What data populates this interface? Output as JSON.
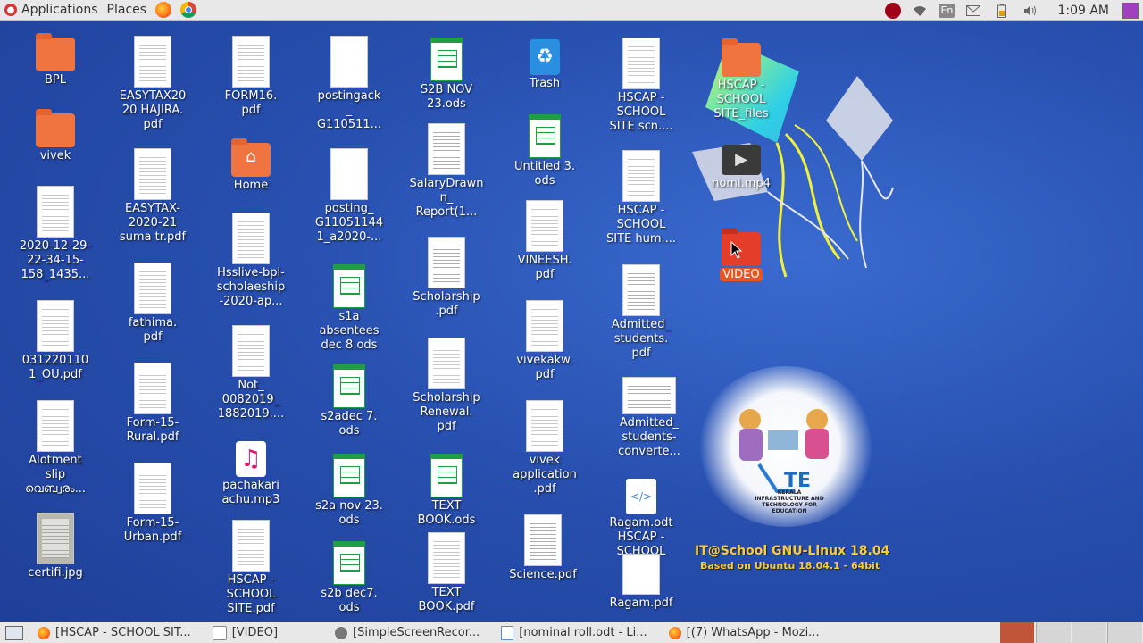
{
  "top_panel": {
    "applications": "Applications",
    "places": "Places",
    "lang": "En",
    "clock": "1:09 AM"
  },
  "desktop": {
    "icons": [
      {
        "label": "BPL",
        "type": "folder"
      },
      {
        "label": "vivek",
        "type": "folder"
      },
      {
        "label": "2020-12-29-\n22-34-15-\n158_1435...",
        "type": "doc"
      },
      {
        "label": "031220110\n1_OU.pdf",
        "type": "doc"
      },
      {
        "label": "Alotment\nslip\nവെബ്വരം...",
        "type": "doc"
      },
      {
        "label": "certifi.jpg",
        "type": "photo"
      },
      {
        "label": "EASYTAX20\n20 HAJIRA.\npdf",
        "type": "doc"
      },
      {
        "label": "EASYTAX-\n2020-21\nsuma tr.pdf",
        "type": "doc"
      },
      {
        "label": "fathima.\npdf",
        "type": "doc"
      },
      {
        "label": "Form-15-\nRural.pdf",
        "type": "doc"
      },
      {
        "label": "Form-15-\nUrban.pdf",
        "type": "doc"
      },
      {
        "label": "FORM16.\npdf",
        "type": "doc"
      },
      {
        "label": "Home",
        "type": "home"
      },
      {
        "label": "Hsslive-bpl-\nscholaeship\n-2020-ap...",
        "type": "doc"
      },
      {
        "label": "Not_\n0082019_\n1882019....",
        "type": "doc"
      },
      {
        "label": "pachakari\nachu.mp3",
        "type": "music"
      },
      {
        "label": "HSCAP -\nSCHOOL\nSITE.pdf",
        "type": "doc"
      },
      {
        "label": "postingack\n_\nG110511...",
        "type": "blank"
      },
      {
        "label": "posting_\nG11051144\n1_a2020-...",
        "type": "blank"
      },
      {
        "label": "s1a\nabsentees\ndec 8.ods",
        "type": "ods"
      },
      {
        "label": "s2adec 7.\nods",
        "type": "ods"
      },
      {
        "label": "s2a nov 23.\nods",
        "type": "ods"
      },
      {
        "label": "s2b dec7.\nods",
        "type": "ods"
      },
      {
        "label": "S2B NOV\n23.ods",
        "type": "ods"
      },
      {
        "label": "SalaryDrawn\nn_\nReport(1...",
        "type": "grid"
      },
      {
        "label": "Scholarship\n.pdf",
        "type": "grid"
      },
      {
        "label": "Scholarship\nRenewal.\npdf",
        "type": "doc"
      },
      {
        "label": "TEXT\nBOOK.ods",
        "type": "ods"
      },
      {
        "label": "TEXT\nBOOK.pdf",
        "type": "doc"
      },
      {
        "label": "Trash",
        "type": "trash"
      },
      {
        "label": "Untitled 3.\nods",
        "type": "ods"
      },
      {
        "label": "VINEESH.\npdf",
        "type": "doc"
      },
      {
        "label": "vivekakw.\npdf",
        "type": "doc"
      },
      {
        "label": "vivek\napplication\n.pdf",
        "type": "doc"
      },
      {
        "label": "Science.pdf",
        "type": "grid"
      },
      {
        "label": "HSCAP -\nSCHOOL\nSITE scn....",
        "type": "doc"
      },
      {
        "label": "HSCAP -\nSCHOOL\nSITE hum....",
        "type": "doc"
      },
      {
        "label": "Admitted_\nstudents.\npdf",
        "type": "grid"
      },
      {
        "label": "Admitted_\nstudents-\nconverte...",
        "type": "wide"
      },
      {
        "label": "Ragam.odt\nHSCAP -\nSCHOOL\nSITE.html",
        "type": "html"
      },
      {
        "label": "Ragam.pdf",
        "type": "blank"
      },
      {
        "label": "HSCAP -\nSCHOOL\nSITE_files",
        "type": "folder"
      },
      {
        "label": "nomi.mp4",
        "type": "video"
      },
      {
        "label": "VIDEO",
        "type": "folder-red"
      }
    ]
  },
  "branding": {
    "line1": "IT@School GNU-Linux 18.04",
    "line2": "Based on Ubuntu 18.04.1 - 64bit",
    "logo_text": "KERALA INFRASTRUCTURE AND TECHNOLOGY FOR EDUCATION"
  },
  "taskbar": {
    "tasks": [
      "[HSCAP - SCHOOL SIT...",
      "[VIDEO]",
      "[SimpleScreenRecor...",
      "[nominal roll.odt - Li...",
      "[(7) WhatsApp - Mozi..."
    ]
  },
  "colors": {
    "panel": "#e8e8e8",
    "desktop": "#2850b0",
    "selection": "#e95420",
    "brand_text": "#ffcc33"
  }
}
